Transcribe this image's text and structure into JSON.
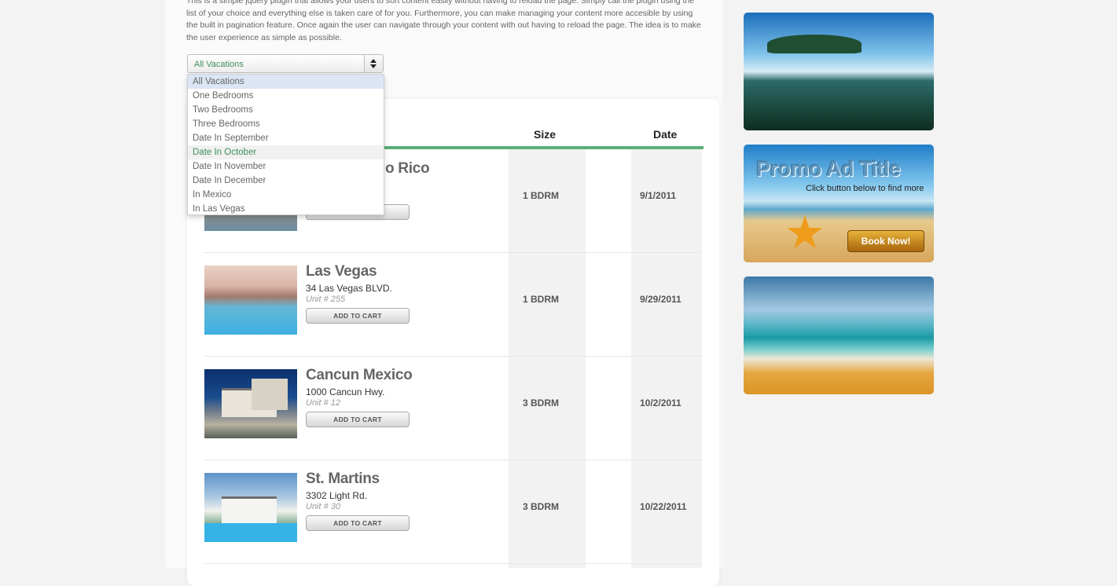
{
  "intro": "This is a simple jquery plugin that allows your users to sort content easily without having to reload the page. Simply call the plugin using the list of your choice and everything else is taken care of for you. Furthermore, you can make managing your content more accesible by using the built in pagination feature. Once again the user can navigate through your content with out having to reload the page. The idea is to make the user experience as simple as possible.",
  "filter": {
    "selected": "All Vacations",
    "options": [
      {
        "label": "All Vacations"
      },
      {
        "label": "One Bedrooms"
      },
      {
        "label": "Two Bedrooms"
      },
      {
        "label": "Three Bedrooms"
      },
      {
        "label": "Date In September"
      },
      {
        "label": "Date In October"
      },
      {
        "label": "Date In November"
      },
      {
        "label": "Date In December"
      },
      {
        "label": "In Mexico"
      },
      {
        "label": "In Las Vegas"
      }
    ]
  },
  "table": {
    "headers": {
      "size": "Size",
      "date": "Date"
    },
    "rows": [
      {
        "title": "Puerto Rico",
        "title_visible": "o Rico",
        "address": "",
        "unit": "",
        "size": "1 BDRM",
        "date": "9/1/2011",
        "button": "ADD TO CART"
      },
      {
        "title": "Las Vegas",
        "address": "34 Las Vegas BLVD.",
        "unit": "Unit # 255",
        "size": "1 BDRM",
        "date": "9/29/2011",
        "button": "ADD TO CART"
      },
      {
        "title": "Cancun Mexico",
        "address": "1000 Cancun Hwy.",
        "unit": "Unit # 12",
        "size": "3 BDRM",
        "date": "10/2/2011",
        "button": "ADD TO CART"
      },
      {
        "title": "St. Martins",
        "address": "3302 Light Rd.",
        "unit": "Unit # 30",
        "size": "3 BDRM",
        "date": "10/22/2011",
        "button": "ADD TO CART"
      }
    ]
  },
  "ads": {
    "promo": {
      "title": "Promo Ad Title",
      "subtitle": "Click button below to find more",
      "button": "Book Now!"
    }
  },
  "icons": {
    "select_arrows": "up-down-arrows-icon",
    "starfish": "starfish-icon"
  },
  "colors": {
    "accent_green": "#5aae76",
    "option_hover": "#3f8f57"
  }
}
